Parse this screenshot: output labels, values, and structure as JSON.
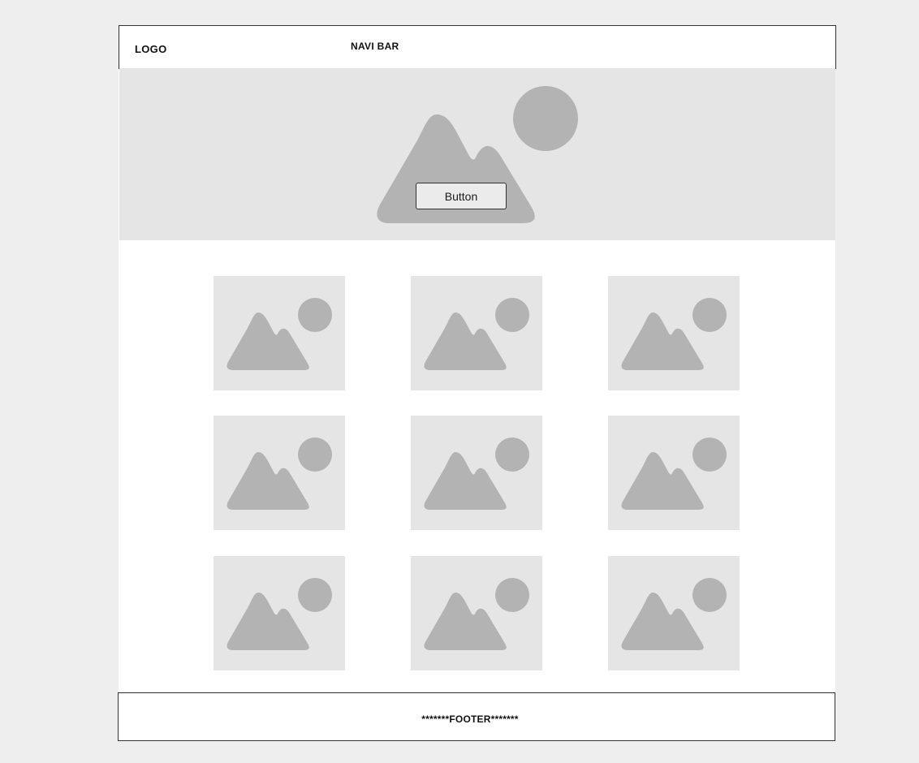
{
  "header": {
    "logo": "LOGO",
    "nav_label": "NAVI BAR"
  },
  "hero": {
    "image_icon": "image-placeholder-icon",
    "button_label": "Button"
  },
  "gallery": {
    "items": [
      {
        "icon": "image-placeholder-icon"
      },
      {
        "icon": "image-placeholder-icon"
      },
      {
        "icon": "image-placeholder-icon"
      },
      {
        "icon": "image-placeholder-icon"
      },
      {
        "icon": "image-placeholder-icon"
      },
      {
        "icon": "image-placeholder-icon"
      },
      {
        "icon": "image-placeholder-icon"
      },
      {
        "icon": "image-placeholder-icon"
      },
      {
        "icon": "image-placeholder-icon"
      }
    ]
  },
  "footer": {
    "text": "*******FOOTER*******"
  },
  "colors": {
    "background": "#eeeeee",
    "placeholder_fill": "#e5e5e5",
    "placeholder_shape": "#b3b3b3",
    "border": "#333333"
  }
}
